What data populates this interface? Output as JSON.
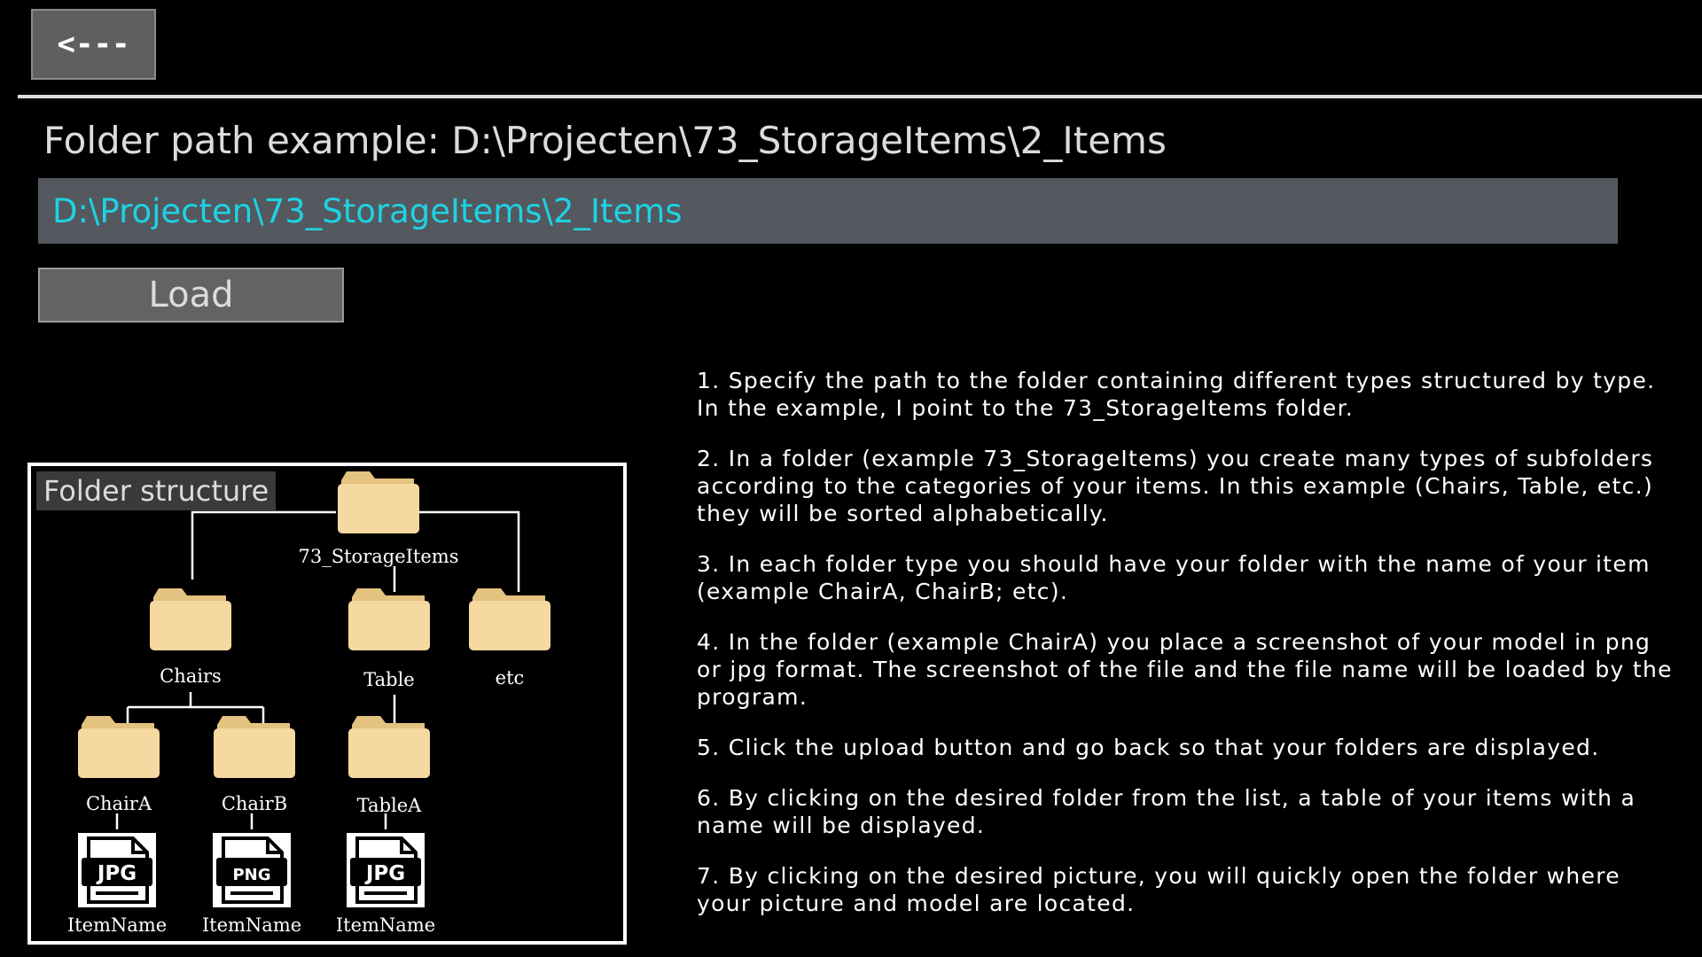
{
  "toolbar": {
    "back_label": "<---"
  },
  "path": {
    "title": "Folder path example: D:\\Projecten\\73_StorageItems\\2_Items",
    "value": "D:\\Projecten\\73_StorageItems\\2_Items"
  },
  "actions": {
    "load_label": "Load"
  },
  "diagram": {
    "title": "Folder structure",
    "root": "73_StorageItems",
    "level1": [
      "Chairs",
      "Table",
      "etc"
    ],
    "level2": [
      "ChairA",
      "ChairB",
      "TableA"
    ],
    "files": [
      {
        "type": "JPG",
        "label": "ItemName"
      },
      {
        "type": "PNG",
        "label": "ItemName"
      },
      {
        "type": "JPG",
        "label": "ItemName"
      }
    ]
  },
  "instructions": [
    "1. Specify the path to the folder containing different types structured by type. In the example, I point to the 73_StorageItems folder.",
    "2. In a folder (example 73_StorageItems) you create many types of subfolders according to the categories of your items. In this example (Chairs, Table, etc.) they will be sorted alphabetically.",
    "3. In each folder type you should have your folder with the name of your item (example ChairA, ChairB; etc).",
    "4. In the folder (example ChairA) you place a screenshot of your model in png or jpg format. The screenshot of the file and the file name will be loaded by the program.",
    "5. Click the upload button and go back so that your folders are displayed.",
    "6. By clicking on the desired folder from the list, a table of your items with a name will be displayed.",
    "7. By clicking on the desired picture, you will quickly open the folder where your picture and model are located."
  ],
  "colors": {
    "background": "#000000",
    "input_background": "#54585f",
    "input_text": "#1dd3e3",
    "folder": "#f6d9a0"
  }
}
